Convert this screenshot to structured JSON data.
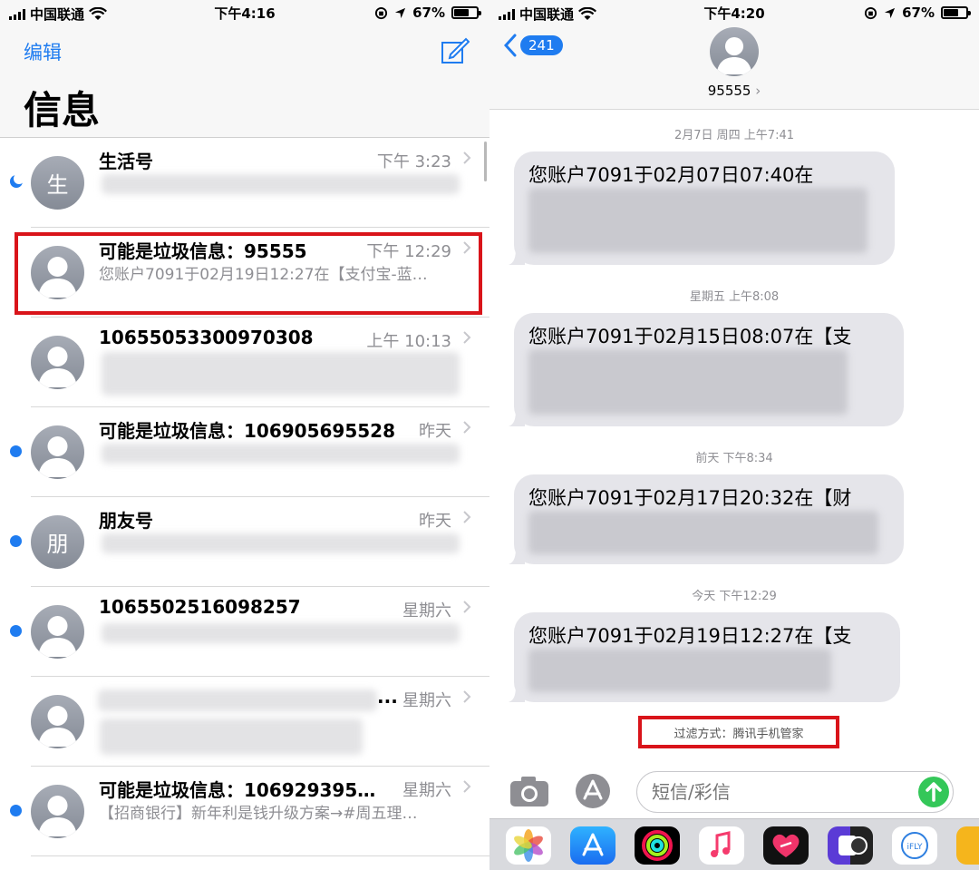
{
  "left": {
    "status": {
      "carrier": "中国联通",
      "time": "下午4:16",
      "battery": "67%",
      "battery_level": 0.67
    },
    "edit_label": "编辑",
    "title": "信息",
    "conversations": [
      {
        "name": "生活号",
        "avatar_letter": "生",
        "time": "下午 3:23",
        "preview": "",
        "unread": false,
        "moon": true
      },
      {
        "name": "可能是垃圾信息：95555",
        "avatar_letter": "",
        "time": "下午 12:29",
        "preview": "您账户7091于02月19日12:27在【支付宝-蓝…",
        "unread": false,
        "moon": false
      },
      {
        "name": "10655053300970308",
        "avatar_letter": "",
        "time": "上午 10:13",
        "preview": "",
        "unread": false,
        "moon": false
      },
      {
        "name": "可能是垃圾信息：106905695528",
        "avatar_letter": "",
        "time": "昨天",
        "preview": "",
        "unread": true,
        "moon": false
      },
      {
        "name": "朋友号",
        "avatar_letter": "朋",
        "time": "昨天",
        "preview": "",
        "unread": true,
        "moon": false
      },
      {
        "name": "1065502516098257",
        "avatar_letter": "",
        "time": "星期六",
        "preview": "",
        "unread": true,
        "moon": false
      },
      {
        "name": "...",
        "avatar_letter": "",
        "time": "星期六",
        "preview": "",
        "unread": false,
        "moon": false
      },
      {
        "name": "可能是垃圾信息：106929395…",
        "avatar_letter": "",
        "time": "星期六",
        "preview": "【招商银行】新年利是钱升级方案→#周五理…",
        "unread": true,
        "moon": false
      }
    ]
  },
  "right": {
    "status": {
      "carrier": "中国联通",
      "time": "下午4:20",
      "battery": "67%",
      "battery_level": 0.67
    },
    "back_count": "241",
    "contact": "95555",
    "messages": [
      {
        "timestamp": "2月7日 周四 上午7:41",
        "text": "您账户7091于02月07日07:40在"
      },
      {
        "timestamp": "星期五 上午8:08",
        "text": "您账户7091于02月15日08:07在【支"
      },
      {
        "timestamp": "前天 下午8:34",
        "text": "您账户7091于02月17日20:32在【财"
      },
      {
        "timestamp": "今天 下午12:29",
        "text": "您账户7091于02月19日12:27在【支"
      }
    ],
    "filter_note": "过滤方式：腾讯手机管家",
    "input_placeholder": "短信/彩信",
    "apps": [
      "photos-icon",
      "app-store-icon",
      "activity-icon",
      "music-icon",
      "heart-app-icon",
      "split-app-icon",
      "ifly-icon",
      "partial-app-icon"
    ]
  }
}
